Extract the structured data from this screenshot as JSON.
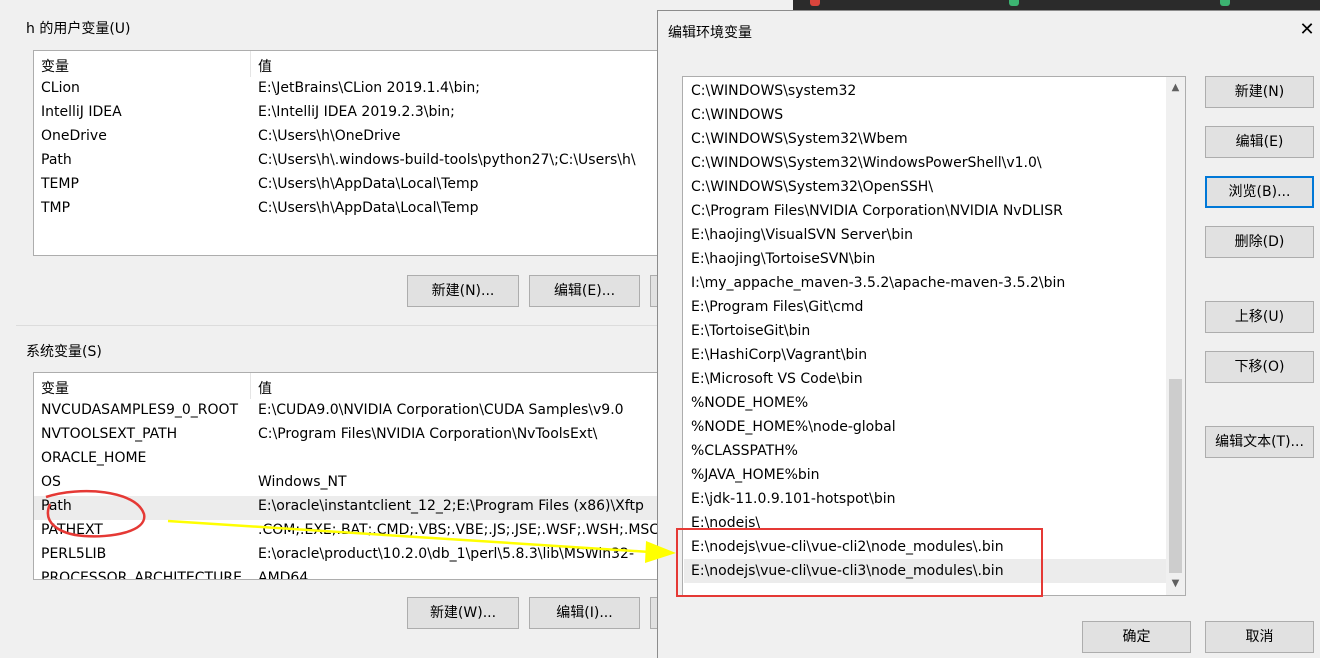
{
  "user_vars": {
    "title": "h 的用户变量(U)",
    "col_var": "变量",
    "col_val": "值",
    "rows": [
      {
        "name": "CLion",
        "value": "E:\\JetBrains\\CLion 2019.1.4\\bin;"
      },
      {
        "name": "IntelliJ IDEA",
        "value": "E:\\IntelliJ IDEA 2019.2.3\\bin;"
      },
      {
        "name": "OneDrive",
        "value": "C:\\Users\\h\\OneDrive"
      },
      {
        "name": "Path",
        "value": "C:\\Users\\h\\.windows-build-tools\\python27\\;C:\\Users\\h\\"
      },
      {
        "name": "TEMP",
        "value": "C:\\Users\\h\\AppData\\Local\\Temp"
      },
      {
        "name": "TMP",
        "value": "C:\\Users\\h\\AppData\\Local\\Temp"
      }
    ],
    "new_label": "新建(N)...",
    "edit_label": "编辑(E)..."
  },
  "system_vars": {
    "title": "系统变量(S)",
    "col_var": "变量",
    "col_val": "值",
    "rows": [
      {
        "name": "NVCUDASAMPLES9_0_ROOT",
        "value": "E:\\CUDA9.0\\NVIDIA Corporation\\CUDA Samples\\v9.0"
      },
      {
        "name": "NVTOOLSEXT_PATH",
        "value": "C:\\Program Files\\NVIDIA Corporation\\NvToolsExt\\"
      },
      {
        "name": "ORACLE_HOME",
        "value": ""
      },
      {
        "name": "OS",
        "value": "Windows_NT"
      },
      {
        "name": "Path",
        "value": "E:\\oracle\\instantclient_12_2;E:\\Program Files (x86)\\Xftp"
      },
      {
        "name": "PATHEXT",
        "value": ".COM;.EXE;.BAT;.CMD;.VBS;.VBE;.JS;.JSE;.WSF;.WSH;.MSC"
      },
      {
        "name": "PERL5LIB",
        "value": "E:\\oracle\\product\\10.2.0\\db_1\\perl\\5.8.3\\lib\\MSWin32-"
      },
      {
        "name": "PROCESSOR_ARCHITECTURE",
        "value": "AMD64"
      }
    ],
    "selected_index": 4,
    "new_label": "新建(W)...",
    "edit_label": "编辑(I)..."
  },
  "edit_dialog": {
    "title": "编辑环境变量",
    "close_glyph": "✕",
    "paths": [
      "C:\\WINDOWS\\system32",
      "C:\\WINDOWS",
      "C:\\WINDOWS\\System32\\Wbem",
      "C:\\WINDOWS\\System32\\WindowsPowerShell\\v1.0\\",
      "C:\\WINDOWS\\System32\\OpenSSH\\",
      "C:\\Program Files\\NVIDIA Corporation\\NVIDIA NvDLISR",
      "E:\\haojing\\VisualSVN Server\\bin",
      "E:\\haojing\\TortoiseSVN\\bin",
      "I:\\my_appache_maven-3.5.2\\apache-maven-3.5.2\\bin",
      "E:\\Program Files\\Git\\cmd",
      "E:\\TortoiseGit\\bin",
      "E:\\HashiCorp\\Vagrant\\bin",
      "E:\\Microsoft VS Code\\bin",
      "%NODE_HOME%",
      "%NODE_HOME%\\node-global",
      "%CLASSPATH%",
      "%JAVA_HOME%bin",
      "E:\\jdk-11.0.9.101-hotspot\\bin",
      "E:\\nodejs\\",
      "E:\\nodejs\\vue-cli\\vue-cli2\\node_modules\\.bin",
      "E:\\nodejs\\vue-cli\\vue-cli3\\node_modules\\.bin"
    ],
    "hover_index": 20,
    "buttons": {
      "new": "新建(N)",
      "edit": "编辑(E)",
      "browse": "浏览(B)...",
      "delete": "删除(D)",
      "move_up": "上移(U)",
      "move_down": "下移(O)",
      "edit_text": "编辑文本(T)...",
      "ok": "确定",
      "cancel": "取消"
    }
  },
  "colors": {
    "annotation_red": "#e53935",
    "annotation_yellow": "#ffff00",
    "focus_blue": "#0078d7"
  }
}
